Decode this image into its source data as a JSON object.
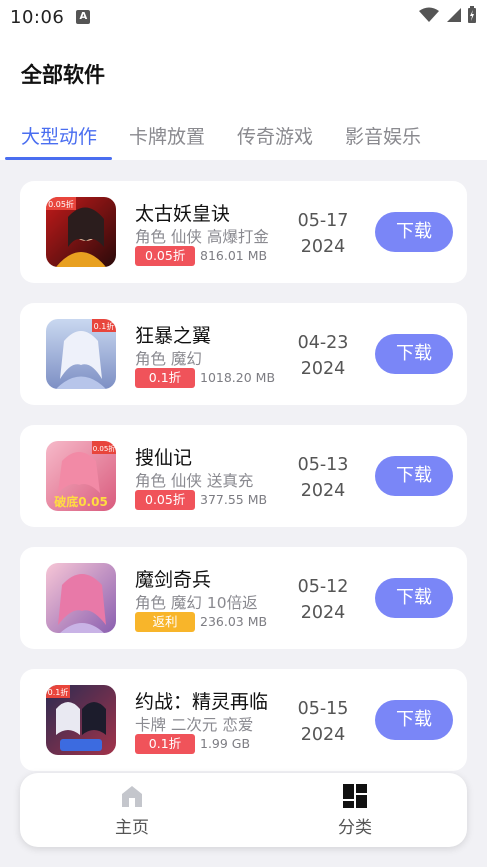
{
  "status": {
    "time": "10:06",
    "notification_icon": "a-icon"
  },
  "header": {
    "title": "全部软件",
    "tabs": [
      {
        "label": "大型动作",
        "active": true
      },
      {
        "label": "卡牌放置",
        "active": false
      },
      {
        "label": "传奇游戏",
        "active": false
      },
      {
        "label": "影音娱乐",
        "active": false
      }
    ]
  },
  "apps": [
    {
      "name": "太古妖皇诀",
      "tags": "角色 仙侠 高爆打金",
      "badge": "0.05折",
      "size": "816.01 MB",
      "date_md": "05-17",
      "date_y": "2024",
      "button": "下载"
    },
    {
      "name": "狂暴之翼",
      "tags": "角色 魔幻",
      "badge": "0.1折",
      "size": "1018.20 MB",
      "date_md": "04-23",
      "date_y": "2024",
      "button": "下载"
    },
    {
      "name": "搜仙记",
      "tags": "角色 仙侠 送真充",
      "badge": "0.05折",
      "size": "377.55 MB",
      "date_md": "05-13",
      "date_y": "2024",
      "button": "下载"
    },
    {
      "name": "魔剑奇兵",
      "tags": "角色 魔幻 10倍返",
      "badge": "返利",
      "size": "236.03 MB",
      "date_md": "05-12",
      "date_y": "2024",
      "button": "下载"
    },
    {
      "name": "约战：精灵再临",
      "tags": "卡牌 二次元 恋爱",
      "badge": "0.1折",
      "size": "1.99 GB",
      "date_md": "05-15",
      "date_y": "2024",
      "button": "下载"
    }
  ],
  "thumb_overlays": [
    "0.05折",
    "0.1折",
    "0.05折",
    "",
    "0.1折"
  ],
  "thumb_captions": [
    "",
    "",
    "破底0.05",
    "",
    ""
  ],
  "nav": {
    "home": "主页",
    "category": "分类"
  },
  "colors": {
    "accent": "#4a6ef0",
    "button": "#7a86f7",
    "badge_red": "#f0535a",
    "badge_yellow": "#f8b52a"
  }
}
